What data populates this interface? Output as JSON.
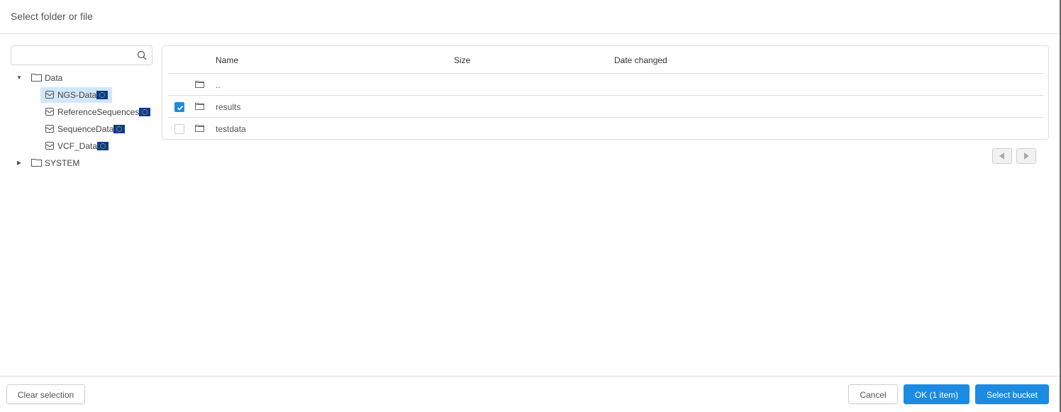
{
  "dialog": {
    "title": "Select folder or file"
  },
  "search": {
    "value": "",
    "placeholder": ""
  },
  "tree": {
    "root": {
      "label": "Data",
      "expanded": true
    },
    "children": [
      {
        "label": "NGS-Data",
        "selected": true,
        "badge": "eu-flag"
      },
      {
        "label": "ReferenceSequences",
        "selected": false,
        "badge": "eu-flag"
      },
      {
        "label": "SequenceData",
        "selected": false,
        "badge": "eu-flag"
      },
      {
        "label": "VCF_Data",
        "selected": false,
        "badge": "eu-flag"
      }
    ],
    "system": {
      "label": "SYSTEM",
      "expanded": false
    }
  },
  "table": {
    "columns": {
      "name": "Name",
      "size": "Size",
      "date": "Date changed"
    },
    "rows": [
      {
        "name": "..",
        "checkable": false,
        "checked": false,
        "size": "",
        "date": ""
      },
      {
        "name": "results",
        "checkable": true,
        "checked": true,
        "size": "",
        "date": ""
      },
      {
        "name": "testdata",
        "checkable": true,
        "checked": false,
        "size": "",
        "date": ""
      }
    ]
  },
  "footer": {
    "clear": "Clear selection",
    "cancel": "Cancel",
    "ok": "OK (1 item)",
    "select_bucket": "Select bucket"
  },
  "colors": {
    "accent": "#1b8be3",
    "selection": "#d2e7f9",
    "eu_blue": "#0d3a91",
    "eu_gold": "#f6d21c"
  }
}
